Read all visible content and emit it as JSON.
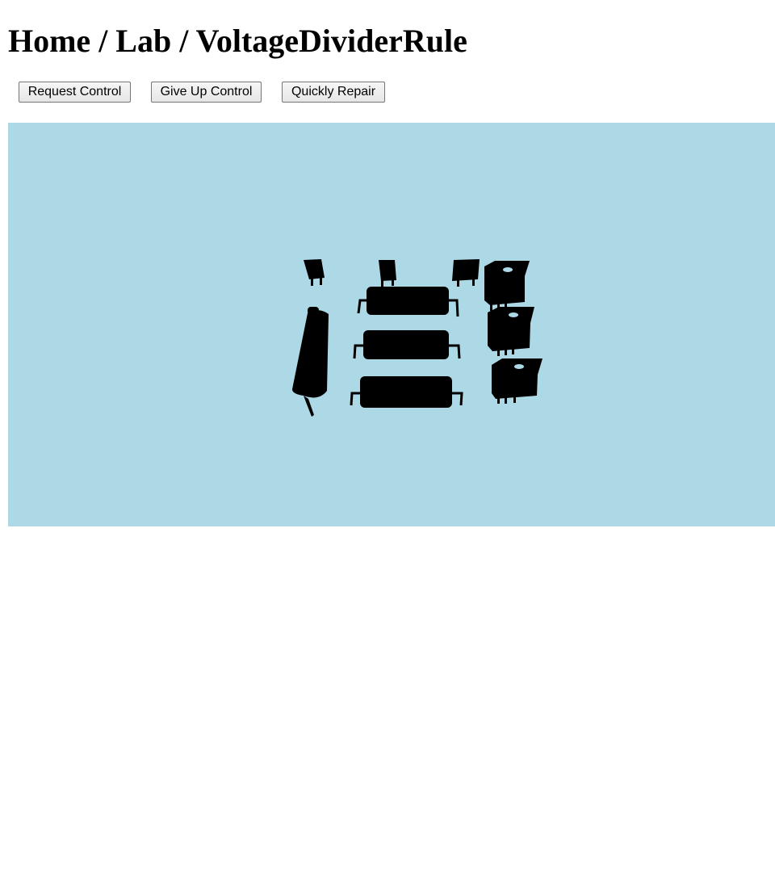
{
  "breadcrumb": {
    "text": "Home / Lab / VoltageDividerRule"
  },
  "toolbar": {
    "request_control_label": "Request Control",
    "give_up_control_label": "Give Up Control",
    "quickly_repair_label": "Quickly Repair"
  },
  "workbench": {
    "background_color": "#add8e6",
    "component_color": "#000000",
    "components": [
      {
        "kind": "switch-icon",
        "count": 3
      },
      {
        "kind": "battery-icon",
        "count": 1
      },
      {
        "kind": "resistor-icon",
        "count": 3
      },
      {
        "kind": "potentiometer-icon",
        "count": 3
      }
    ]
  }
}
